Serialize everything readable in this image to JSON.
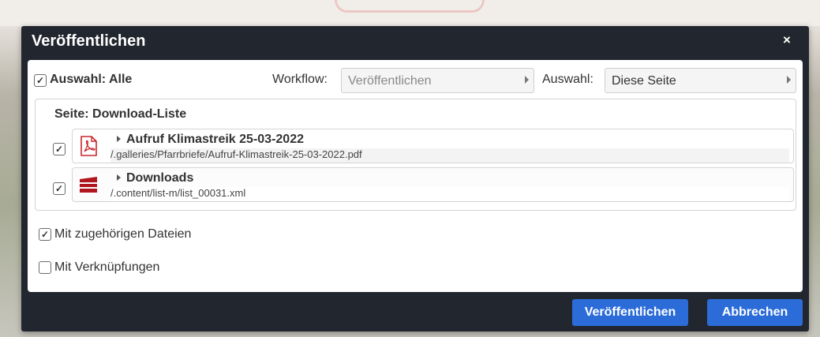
{
  "dialog": {
    "title": "Veröffentlichen",
    "close_label": "×"
  },
  "selection": {
    "label": "Auswahl: Alle",
    "checked": true
  },
  "workflow": {
    "label": "Workflow:",
    "value": "Veröffentlichen"
  },
  "scope": {
    "label": "Auswahl:",
    "value": "Diese Seite"
  },
  "page_section": {
    "title": "Seite: Download-Liste",
    "resources": [
      {
        "title": "Aufruf Klimastreik 25-03-2022",
        "path": "/.galleries/Pfarrbriefe/Aufruf-Klimastreik-25-03-2022.pdf",
        "icon": "pdf-icon",
        "checked": true
      },
      {
        "title": "Downloads",
        "path": "/.content/list-m/list_00031.xml",
        "icon": "list-icon",
        "checked": true
      }
    ]
  },
  "options": {
    "related_files": {
      "label": "Mit zugehörigen Dateien",
      "checked": true
    },
    "links": {
      "label": "Mit Verknüpfungen",
      "checked": false
    }
  },
  "buttons": {
    "publish": "Veröffentlichen",
    "cancel": "Abbrechen"
  },
  "colors": {
    "dialog_bg": "#22262e",
    "button_blue": "#2b6cd9",
    "pdf_red": "#c8262c",
    "list_red": "#b0161e"
  }
}
